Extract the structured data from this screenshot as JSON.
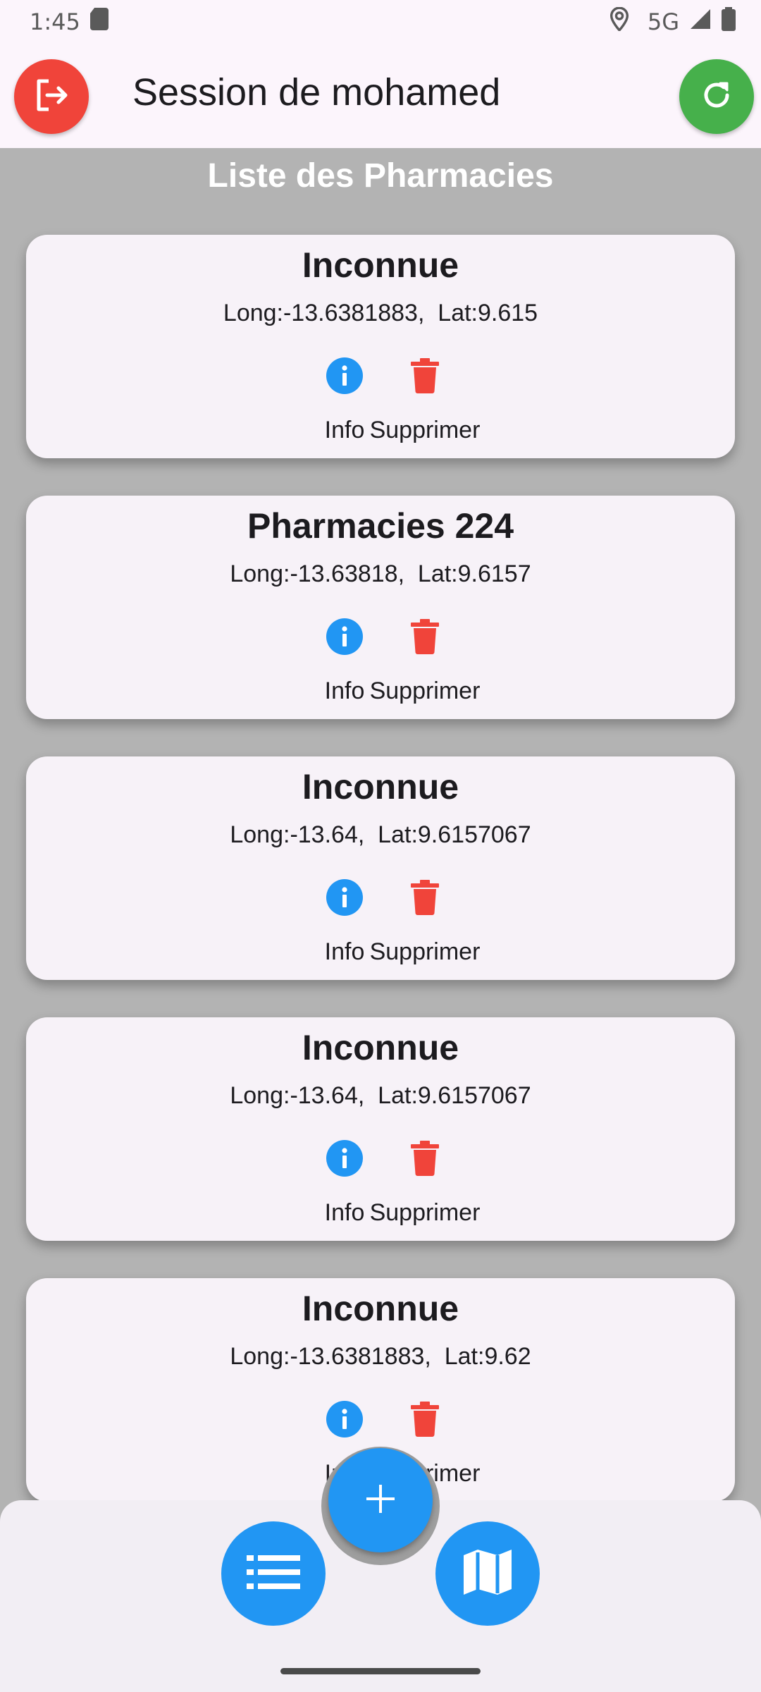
{
  "status_bar": {
    "time": "1:45",
    "network": "5G",
    "icons": [
      "sd-card-icon",
      "location-icon",
      "signal-icon",
      "battery-icon"
    ]
  },
  "app_bar": {
    "title": "Session de mohamed",
    "logout_icon": "logout-icon",
    "refresh_icon": "refresh-icon",
    "colors": {
      "logout": "#f0443a",
      "refresh": "#46b04b",
      "background": "#fcf5fc"
    }
  },
  "list": {
    "title": "Liste des Pharmacies",
    "info_label": "Info",
    "delete_label": "Supprimer",
    "info_color": "#2196f3",
    "delete_color": "#f0443a",
    "pharmacies": [
      {
        "name": "Inconnue",
        "coords": "Long:-13.6381883,  Lat:9.615"
      },
      {
        "name": "Pharmacies 224",
        "coords": "Long:-13.63818,  Lat:9.6157"
      },
      {
        "name": "Inconnue",
        "coords": "Long:-13.64,  Lat:9.6157067"
      },
      {
        "name": "Inconnue",
        "coords": "Long:-13.64,  Lat:9.6157067"
      },
      {
        "name": "Inconnue",
        "coords": "Long:-13.6381883,  Lat:9.62"
      }
    ]
  },
  "bottom_nav": {
    "list_icon": "list-icon",
    "map_icon": "map-icon",
    "add_icon": "add-icon",
    "accent": "#2196f3"
  }
}
